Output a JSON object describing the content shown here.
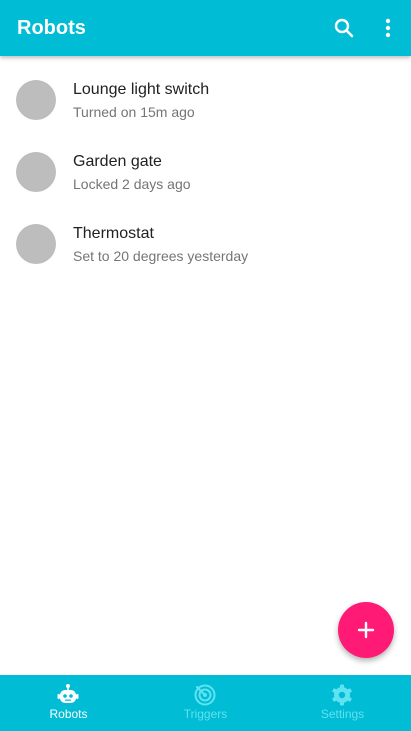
{
  "app_bar": {
    "title": "Robots",
    "search_icon": "search-icon",
    "more_icon": "more-vert-icon"
  },
  "robots": [
    {
      "name": "Lounge light switch",
      "status": "Turned on 15m ago"
    },
    {
      "name": "Garden gate",
      "status": "Locked 2 days ago"
    },
    {
      "name": "Thermostat",
      "status": "Set to 20 degrees yesterday"
    }
  ],
  "fab": {
    "icon": "plus-icon"
  },
  "bottom_nav": {
    "items": [
      {
        "label": "Robots",
        "icon": "robot-icon",
        "active": true
      },
      {
        "label": "Triggers",
        "icon": "radar-icon",
        "active": false
      },
      {
        "label": "Settings",
        "icon": "gear-icon",
        "active": false
      }
    ]
  },
  "colors": {
    "primary": "#00bcd4",
    "accent": "#ff1a75",
    "avatar_placeholder": "#bdbdbd",
    "nav_active": "#ffffff",
    "nav_inactive": "#5fe3f2"
  }
}
